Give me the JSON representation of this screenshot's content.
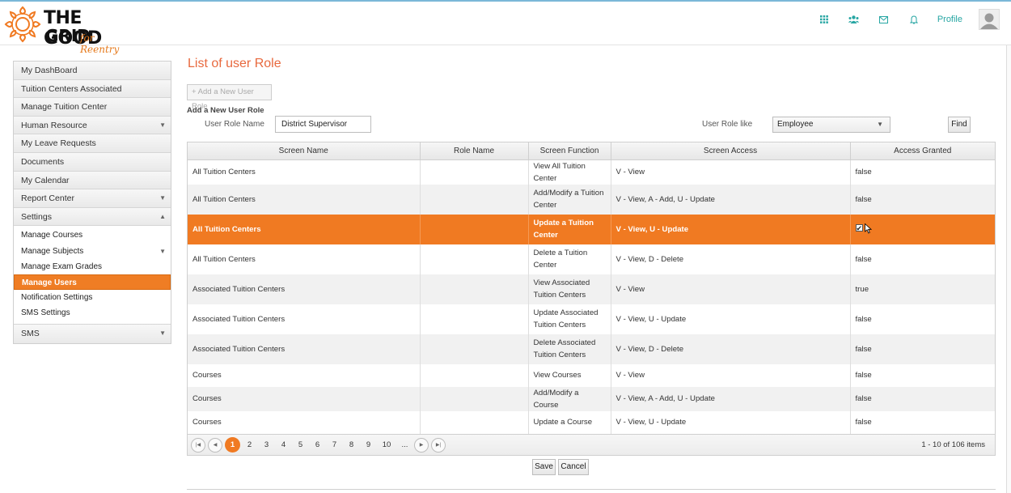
{
  "logo": {
    "line1": "THE GOOD",
    "line2": "GRID",
    "tagline": "for Reentry"
  },
  "topnav": {
    "icons": [
      "grid-icon",
      "users-icon",
      "mail-icon",
      "bell-icon"
    ],
    "profile_label": "Profile",
    "accent": "#27a6a3"
  },
  "sidebar": {
    "items": [
      {
        "label": "My DashBoard"
      },
      {
        "label": "Tuition Centers Associated"
      },
      {
        "label": "Manage Tuition Center"
      },
      {
        "label": "Human Resource",
        "caret": "▼"
      },
      {
        "label": "My Leave Requests"
      },
      {
        "label": "Documents"
      },
      {
        "label": "My Calendar"
      },
      {
        "label": "Report Center",
        "caret": "▼"
      },
      {
        "label": "Settings",
        "caret": "▲"
      }
    ],
    "settings_sub": [
      {
        "label": "Manage Courses"
      },
      {
        "label": "Manage Subjects",
        "caret": "▼"
      },
      {
        "label": "Manage Exam Grades"
      },
      {
        "label": "Manage Users"
      },
      {
        "label": "Notification Settings"
      },
      {
        "label": "SMS Settings"
      }
    ],
    "last": {
      "label": "SMS",
      "caret": "▼"
    }
  },
  "main": {
    "title": "List of user Role",
    "add_button": "+ Add a New User Role",
    "form_title": "Add a New User Role",
    "role_name_label": "User Role Name",
    "role_name_value": "District Supervisor",
    "role_like_label": "User Role like",
    "role_like_value": "Employee",
    "find_label": "Find",
    "save_label": "Save",
    "cancel_label": "Cancel",
    "accent": "#f07a22"
  },
  "grid": {
    "columns": [
      "Screen Name",
      "Role Name",
      "Screen Function",
      "Screen Access",
      "Access Granted"
    ],
    "rows": [
      {
        "screen": "All Tuition Centers",
        "role": "",
        "func": "View All Tuition Center",
        "access": "V - View",
        "granted": "false"
      },
      {
        "screen": "All Tuition Centers",
        "role": "",
        "func": "Add/Modify a Tuition Center",
        "access": "V - View, A - Add, U - Update",
        "granted": "false"
      },
      {
        "screen": "All Tuition Centers",
        "role": "",
        "func": "Update a Tuition Center",
        "access": "V - View, U - Update",
        "granted": "checked"
      },
      {
        "screen": "All Tuition Centers",
        "role": "",
        "func": "Delete a Tuition Center",
        "access": "V - View, D - Delete",
        "granted": "false"
      },
      {
        "screen": "Associated Tuition Centers",
        "role": "",
        "func": "View Associated Tuition Centers",
        "access": "V - View",
        "granted": "true"
      },
      {
        "screen": "Associated Tuition Centers",
        "role": "",
        "func": "Update Associated Tuition Centers",
        "access": "V - View, U - Update",
        "granted": "false"
      },
      {
        "screen": "Associated Tuition Centers",
        "role": "",
        "func": "Delete Associated Tuition Centers",
        "access": "V - View, D - Delete",
        "granted": "false"
      },
      {
        "screen": "Courses",
        "role": "",
        "func": "View Courses",
        "access": "V - View",
        "granted": "false"
      },
      {
        "screen": "Courses",
        "role": "",
        "func": "Add/Modify a Course",
        "access": "V - View, A - Add, U - Update",
        "granted": "false"
      },
      {
        "screen": "Courses",
        "role": "",
        "func": "Update a Course",
        "access": "V - View, U - Update",
        "granted": "false"
      }
    ],
    "pager": {
      "pages": [
        "1",
        "2",
        "3",
        "4",
        "5",
        "6",
        "7",
        "8",
        "9",
        "10",
        "..."
      ],
      "current": "1",
      "info": "1 - 10 of 106 items"
    }
  }
}
